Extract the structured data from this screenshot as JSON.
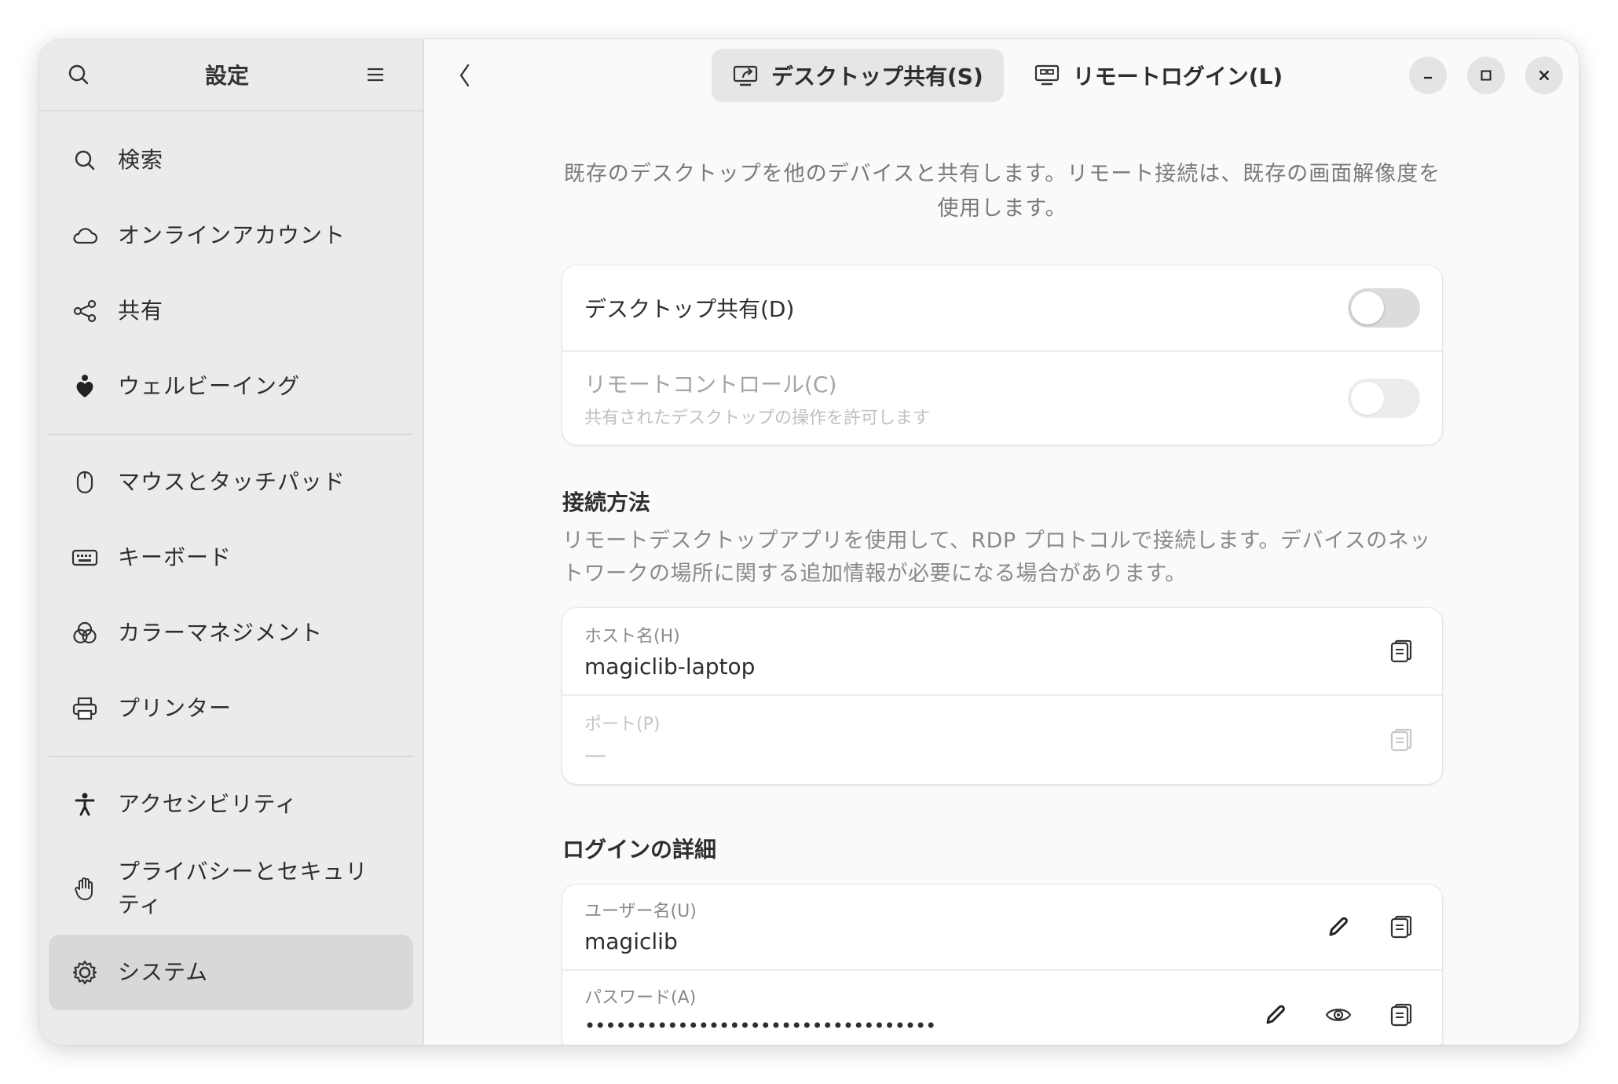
{
  "sidebar": {
    "title": "設定",
    "items": [
      {
        "label": "検索",
        "icon": "search-icon"
      },
      {
        "label": "オンラインアカウント",
        "icon": "cloud-icon"
      },
      {
        "label": "共有",
        "icon": "share-icon"
      },
      {
        "label": "ウェルビーイング",
        "icon": "wellbeing-icon"
      },
      {
        "label": "マウスとタッチパッド",
        "icon": "mouse-icon"
      },
      {
        "label": "キーボード",
        "icon": "keyboard-icon"
      },
      {
        "label": "カラーマネジメント",
        "icon": "color-icon"
      },
      {
        "label": "プリンター",
        "icon": "printer-icon"
      },
      {
        "label": "アクセシビリティ",
        "icon": "accessibility-icon"
      },
      {
        "label": "プライバシーとセキュリティ",
        "icon": "hand-icon"
      },
      {
        "label": "システム",
        "icon": "gear-icon"
      }
    ]
  },
  "tabs": [
    {
      "label": "デスクトップ共有(S)",
      "active": true
    },
    {
      "label": "リモートログイン(L)",
      "active": false
    }
  ],
  "intro": "既存のデスクトップを他のデバイスと共有します。リモート接続は、既存の画面解像度を使用します。",
  "sharing": {
    "desktop_sharing": {
      "label": "デスクトップ共有(D)",
      "on": false
    },
    "remote_control": {
      "label": "リモートコントロール(C)",
      "sub": "共有されたデスクトップの操作を許可します",
      "on": false
    }
  },
  "connection": {
    "title": "接続方法",
    "desc": "リモートデスクトップアプリを使用して、RDP プロトコルで接続します。デバイスのネットワークの場所に関する追加情報が必要になる場合があります。",
    "hostname_label": "ホスト名(H)",
    "hostname_value": "magiclib-laptop",
    "port_label": "ポート(P)",
    "port_value": "—"
  },
  "login": {
    "title": "ログインの詳細",
    "username_label": "ユーザー名(U)",
    "username_value": "magiclib",
    "password_label": "パスワード(A)",
    "password_value": "••••••••••••••••••••••••••••••••••"
  }
}
